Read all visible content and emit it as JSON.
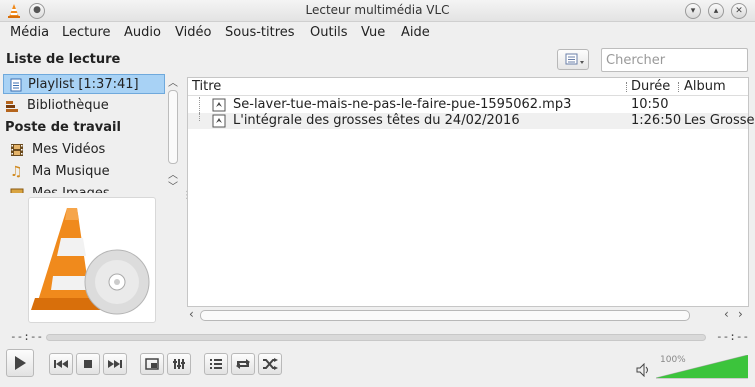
{
  "window": {
    "title": "Lecteur multimédia VLC",
    "menu_icon": "dot-icon"
  },
  "menu": [
    "Média",
    "Lecture",
    "Audio",
    "Vidéo",
    "Sous-titres",
    "Outils",
    "Vue",
    "Aide"
  ],
  "playlist_header": "Liste de lecture",
  "search": {
    "placeholder": "Chercher"
  },
  "sidebar": {
    "playlist": {
      "label": "Playlist [1:37:41]",
      "icon": "playlist-icon"
    },
    "library": {
      "label": "Bibliothèque",
      "icon": "library-icon"
    },
    "section": "Poste de travail",
    "items": [
      {
        "label": "Mes Vidéos",
        "icon": "film-icon"
      },
      {
        "label": "Ma Musique",
        "icon": "music-note-icon"
      },
      {
        "label": "Mes Images",
        "icon": "images-icon"
      }
    ]
  },
  "table": {
    "columns": {
      "title": "Titre",
      "duration": "Durée",
      "album": "Album"
    },
    "rows": [
      {
        "title": "Se-laver-tue-mais-ne-pas-le-faire-pue-1595062.mp3",
        "duration": "10:50",
        "album": ""
      },
      {
        "title": "L'intégrale des grosses têtes du 24/02/2016",
        "duration": "1:26:50",
        "album": "Les Grosse"
      }
    ]
  },
  "seek": {
    "elapsed": "--:--",
    "remaining": "--:--"
  },
  "volume": {
    "percent_label": "100%",
    "level": 1.0
  },
  "colors": {
    "accent_selected": "#a8d2f5",
    "volume_green": "#3cc43c",
    "cone_orange": "#f08a1c"
  }
}
